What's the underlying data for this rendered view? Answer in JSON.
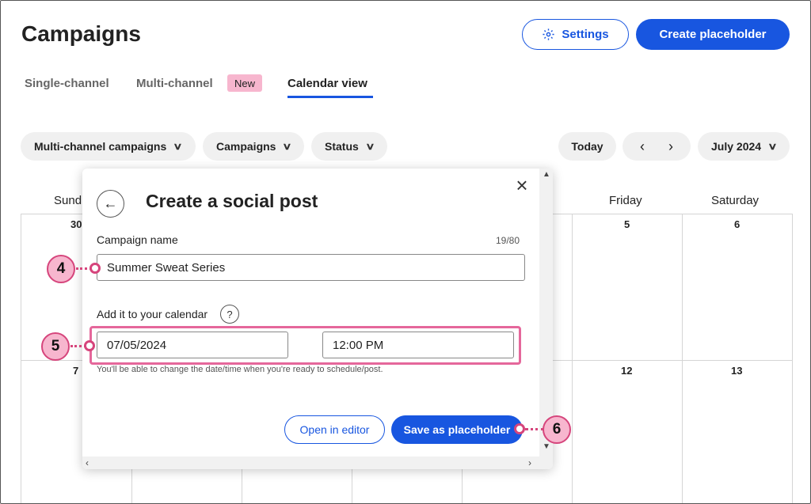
{
  "header": {
    "title": "Campaigns",
    "settings_label": "Settings",
    "create_label": "Create placeholder"
  },
  "tabs": [
    {
      "label": "Single-channel",
      "active": false
    },
    {
      "label": "Multi-channel",
      "active": false,
      "badge": "New"
    },
    {
      "label": "Calendar view",
      "active": true
    }
  ],
  "filters": {
    "multichannel": "Multi-channel campaigns",
    "campaigns": "Campaigns",
    "status": "Status",
    "today": "Today",
    "month": "July 2024"
  },
  "calendar": {
    "day_headers": [
      "Sund",
      "Friday",
      "Saturday"
    ],
    "row1": [
      "30",
      "5",
      "6"
    ],
    "row2": [
      "7",
      "12",
      "13"
    ]
  },
  "modal": {
    "title": "Create a social post",
    "campaign_name_label": "Campaign name",
    "counter": "19/80",
    "campaign_name_value": "Summer Sweat Series",
    "calendar_label": "Add it to your calendar",
    "help_glyph": "?",
    "date_value": "07/05/2024",
    "time_value": "12:00 PM",
    "hint": "You'll be able to change the date/time when you're ready to schedule/post.",
    "open_editor_label": "Open in editor",
    "save_label": "Save as placeholder"
  },
  "callouts": [
    "4",
    "5",
    "6"
  ],
  "colors": {
    "accent": "#1856e0",
    "callout_fill": "#f7b6ce",
    "callout_stroke": "#d6457c"
  }
}
